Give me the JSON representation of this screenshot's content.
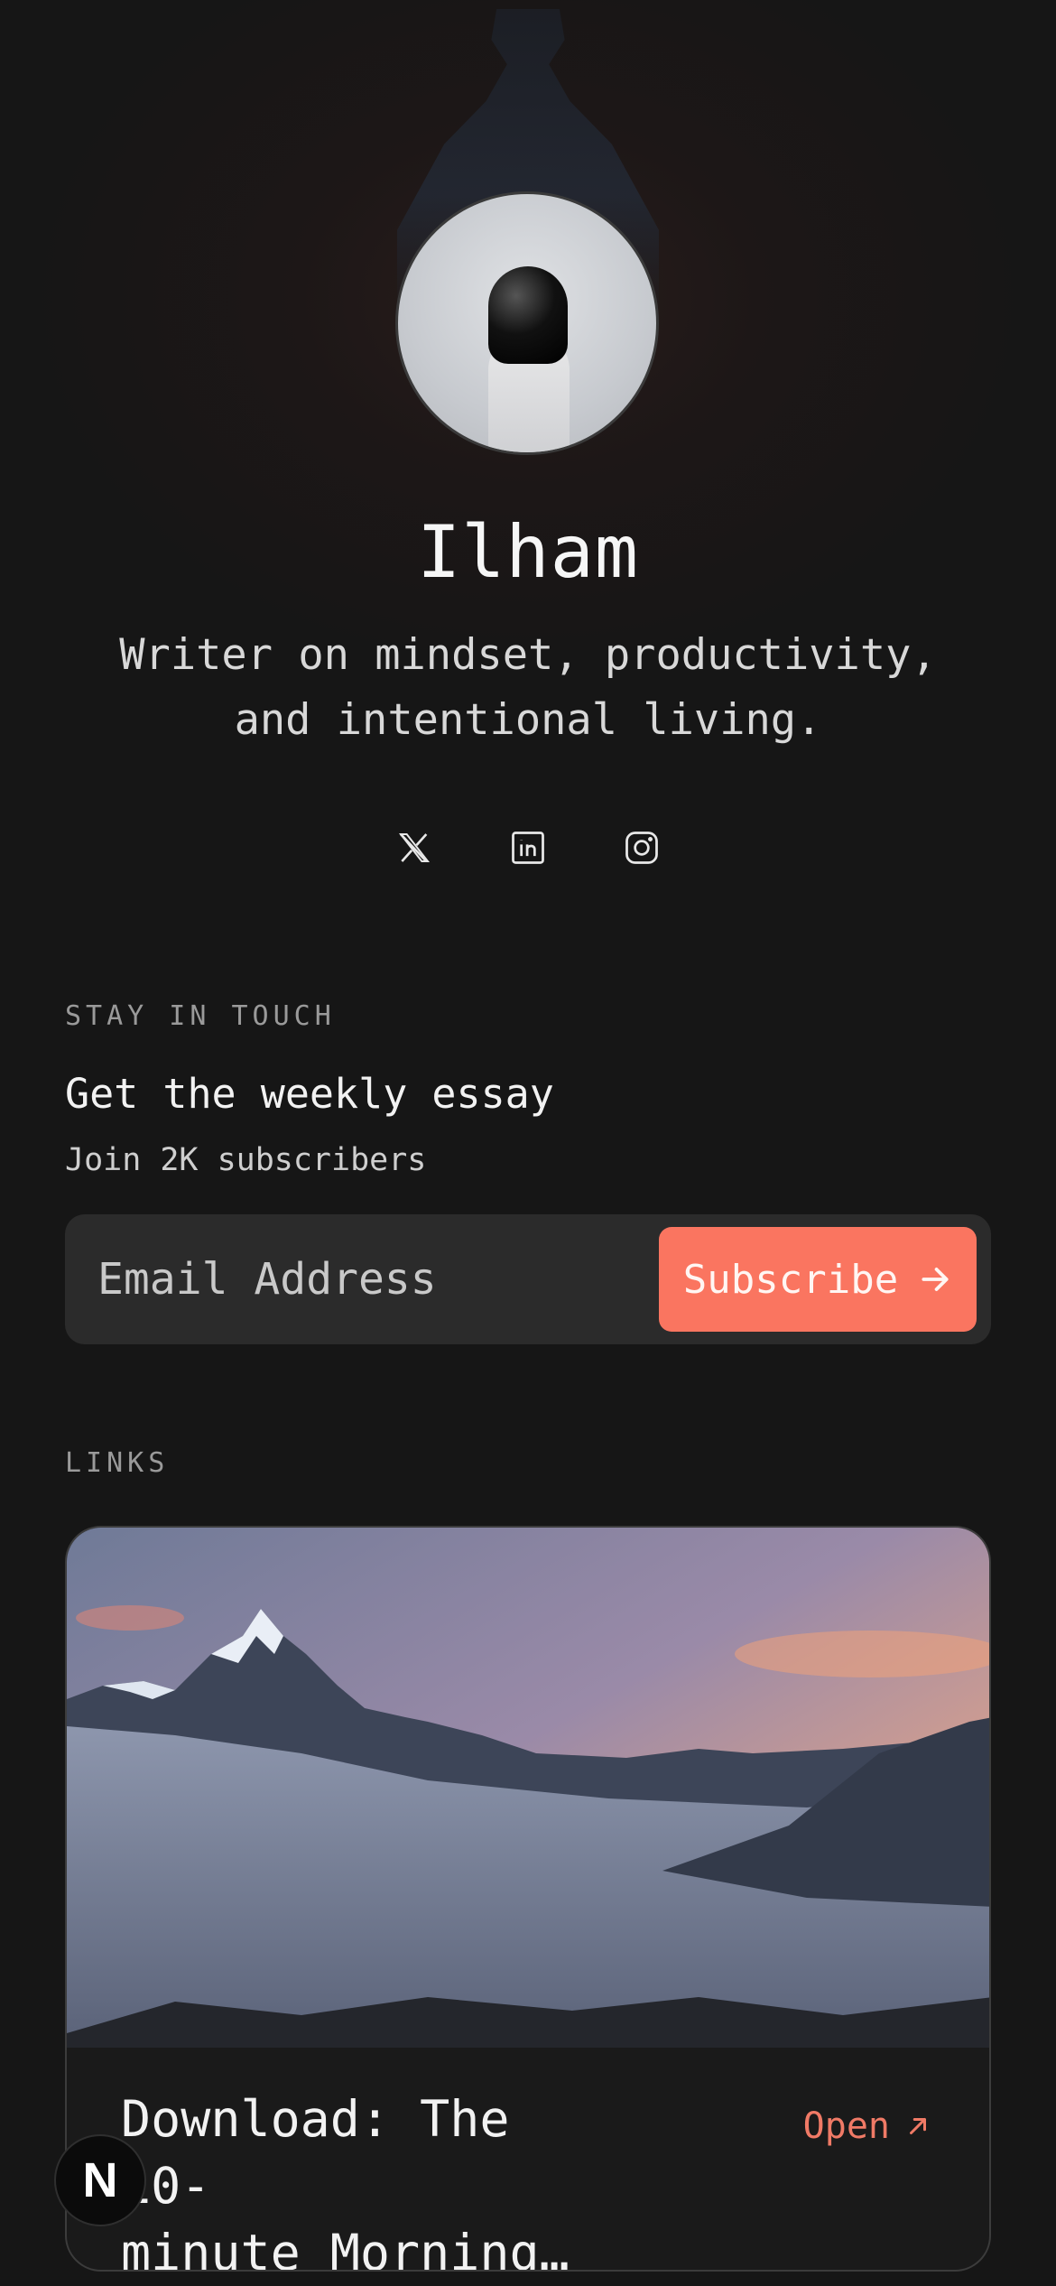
{
  "profile": {
    "name": "Ilham",
    "bio_line1": "Writer on mindset, productivity,",
    "bio_line2": "and intentional living."
  },
  "socials": [
    {
      "icon": "x-icon"
    },
    {
      "icon": "linkedin-icon"
    },
    {
      "icon": "instagram-icon"
    }
  ],
  "newsletter": {
    "eyebrow": "STAY IN TOUCH",
    "heading": "Get the weekly essay",
    "subtext": "Join 2K subscribers",
    "email_placeholder": "Email Address",
    "button_label": "Subscribe"
  },
  "links": {
    "eyebrow": "LINKS",
    "items": [
      {
        "title": "Download: The 10-minute Morning…",
        "title_line1": "Download: The 10-",
        "title_line2": "minute Morning…",
        "action": "Open"
      }
    ]
  },
  "badge": {
    "label": "N"
  },
  "colors": {
    "background": "#161616",
    "accent": "#fa7560",
    "input_bg": "#2b2b2b"
  }
}
